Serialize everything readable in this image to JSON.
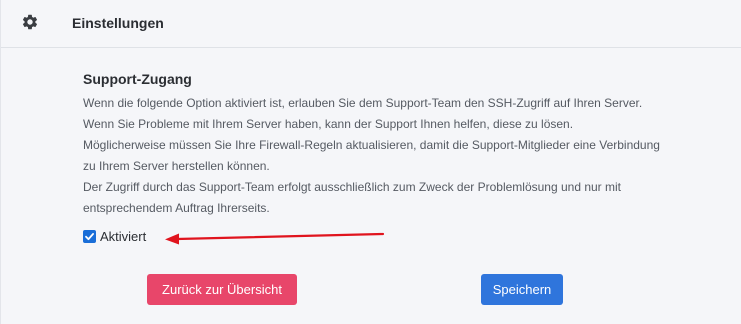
{
  "header": {
    "title": "Einstellungen",
    "icon": "gear-icon"
  },
  "section": {
    "title": "Support-Zugang",
    "description_lines": [
      "Wenn die folgende Option aktiviert ist, erlauben Sie dem Support-Team den SSH-Zugriff auf Ihren Server.",
      "Wenn Sie Probleme mit Ihrem Server haben, kann der Support Ihnen helfen, diese zu lösen.",
      "Möglicherweise müssen Sie Ihre Firewall-Regeln aktualisieren, damit die Support-Mitglieder eine Verbindung",
      "zu Ihrem Server herstellen können.",
      "Der Zugriff durch das Support-Team erfolgt ausschließlich zum Zweck der Problemlösung und nur mit",
      "entsprechendem Auftrag Ihrerseits."
    ]
  },
  "checkbox": {
    "label": "Aktiviert",
    "checked": true
  },
  "buttons": {
    "back_label": "Zurück zur Übersicht",
    "save_label": "Speichern"
  },
  "colors": {
    "accent_blue": "#2f75dc",
    "back_button": "#e8466a",
    "annotation_arrow": "#e0141e"
  }
}
